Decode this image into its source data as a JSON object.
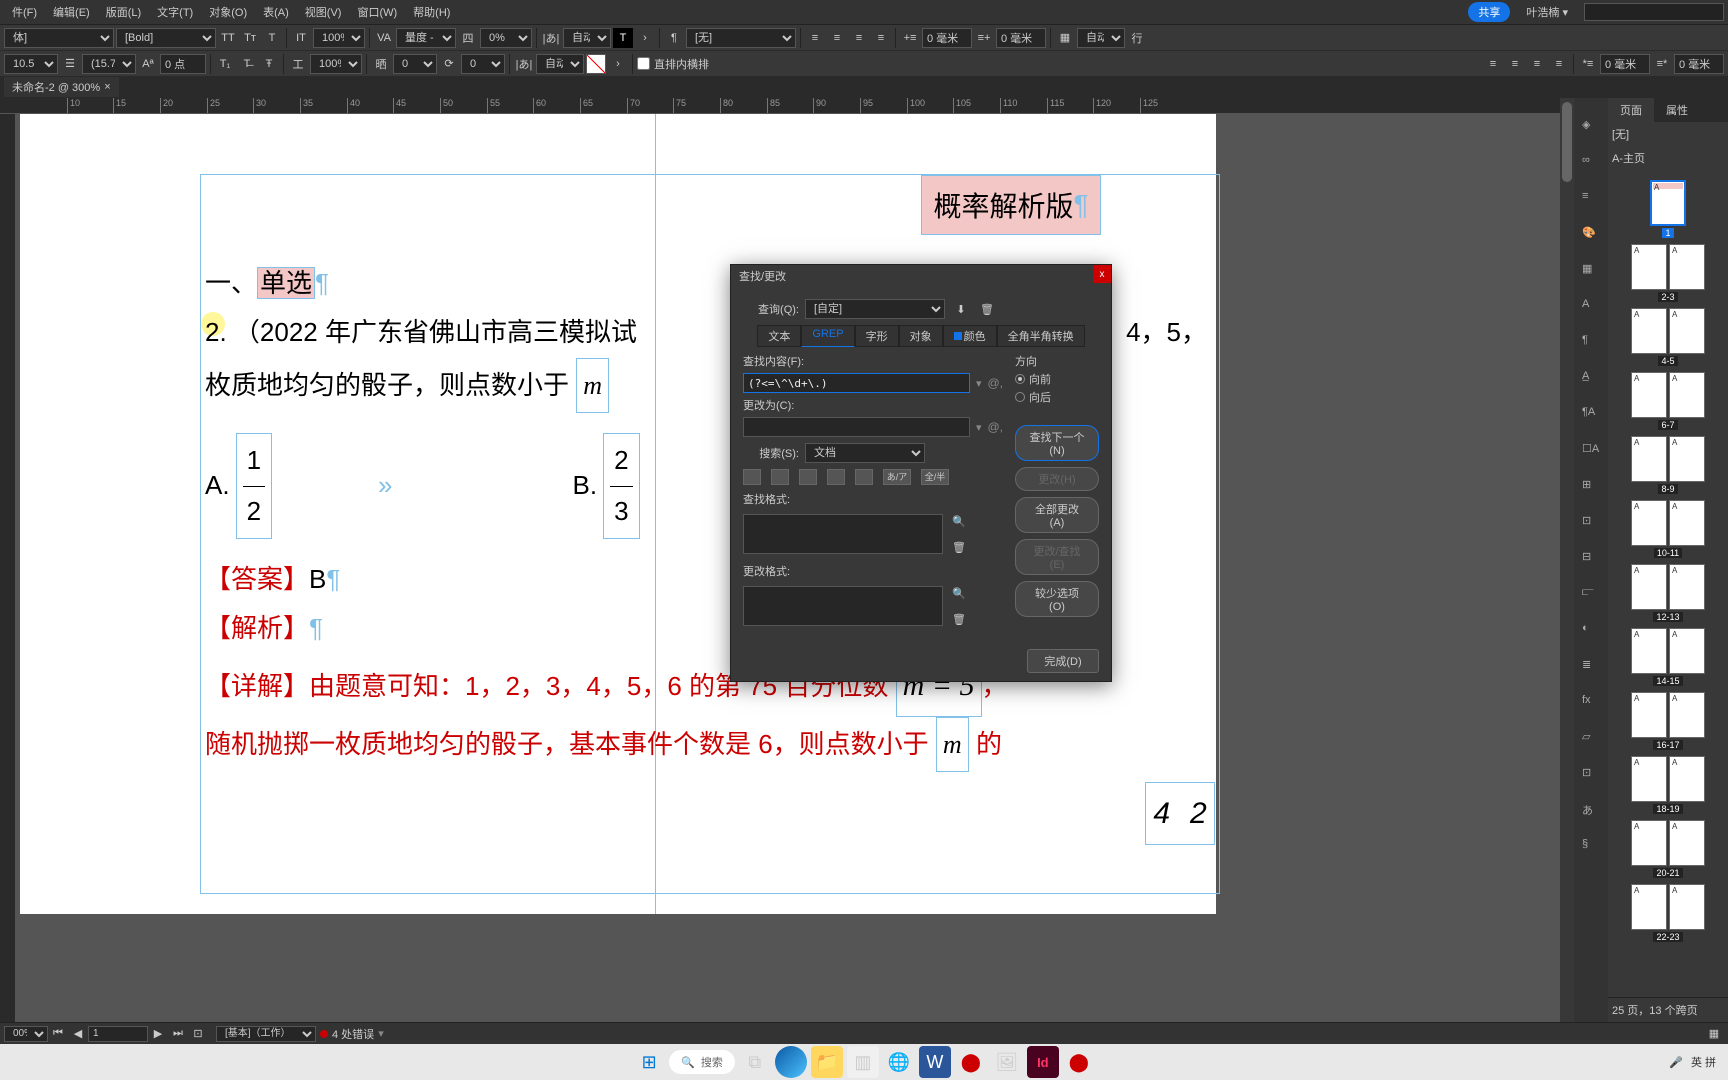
{
  "menubar": {
    "items": [
      "件(F)",
      "编辑(E)",
      "版面(L)",
      "文字(T)",
      "对象(O)",
      "表(A)",
      "视图(V)",
      "窗口(W)",
      "帮助(H)"
    ],
    "share": "共享",
    "user": "叶浩楠"
  },
  "toolbar1": {
    "font_family": "体]",
    "font_style": "[Bold]",
    "scale_pct": "100%",
    "measure_label": "量度 - 优",
    "pct2": "0%",
    "auto1": "自动",
    "style_none": "[无]",
    "left_indent": "0 毫米",
    "right_indent": "0 毫米",
    "columns": "自动",
    "col_icon": "行"
  },
  "toolbar2": {
    "size": "10.5 点",
    "leading": "(15.75 ",
    "baseline": "0 点",
    "scale_pct": "100%",
    "val1": "0",
    "val2": "0",
    "auto2": "自动",
    "checkbox_label": "直排内横排",
    "indent1": "0 毫米",
    "indent2": "0 毫米"
  },
  "doc_tab": "未命名-2 @ 300%",
  "ruler_ticks": [
    "10",
    "15",
    "20",
    "25",
    "30",
    "35",
    "40",
    "45",
    "50",
    "55",
    "60",
    "65",
    "70",
    "75",
    "80",
    "85",
    "90",
    "95",
    "100",
    "105",
    "110",
    "115",
    "120",
    "125"
  ],
  "page": {
    "title_box": "概率解析版",
    "heading_prefix": "一、",
    "heading_text": "单选",
    "q_num": "2.",
    "q_line1": "（2022 年广东省佛山市高三模拟试",
    "q_numbers_right": "4，5，",
    "q_line2": "枚质地均匀的骰子，则点数小于",
    "math_m": "m",
    "opt_a": "A.",
    "opt_a_frac_num": "1",
    "opt_a_frac_den": "2",
    "opt_b": "B.",
    "opt_b_frac_num": "2",
    "opt_b_frac_den": "3",
    "answer_label": "【答案】",
    "answer_val": "B",
    "analysis_label": "【解析】",
    "detail_label": "【详解】",
    "detail_text1": "由题意可知：1，2，3，4，5，6 的第 75 百分位数",
    "math_eq": "m = 5",
    "detail_comma": "，",
    "detail_text2": "随机抛掷一枚质地均匀的骰子，基本事件个数是 6，则点数小于",
    "math_m2": "m",
    "detail_text2_end": "的",
    "frac_bottom_num": "4",
    "frac_bottom_den": "2",
    "arrows": "»"
  },
  "dialog": {
    "title": "查找/更改",
    "query_label": "查询(Q):",
    "query_val": "[自定]",
    "tabs": [
      "文本",
      "GREP",
      "字形",
      "对象",
      "颜色",
      "全角半角转换"
    ],
    "find_label": "查找内容(F):",
    "find_val": "(?<=\\^\\d+\\.)",
    "change_label": "更改为(C):",
    "change_val": "",
    "search_label": "搜索(S):",
    "search_val": "文档",
    "find_format_label": "查找格式:",
    "change_format_label": "更改格式:",
    "direction_label": "方向",
    "dir_fwd": "向前",
    "dir_back": "向后",
    "btn_find_next": "查找下一个(N)",
    "btn_change": "更改(H)",
    "btn_change_all": "全部更改(A)",
    "btn_change_find": "更改/查找(E)",
    "btn_fewer": "较少选项(O)",
    "btn_done": "完成(D)",
    "icon_labels": [
      "あ/ア",
      "全/半"
    ]
  },
  "right_panel": {
    "tab1": "页面",
    "tab2": "属性",
    "master_none": "[无]",
    "master_a": "A-主页",
    "page_ranges": [
      "1",
      "2-3",
      "4-5",
      "6-7",
      "8-9",
      "10-11",
      "12-13",
      "14-15",
      "16-17",
      "18-19",
      "20-21",
      "22-23"
    ],
    "footer": "25 页，13 个跨页"
  },
  "statusbar": {
    "zoom": "00%",
    "page": "1",
    "style": "[基本]（工作）",
    "errors": "4 处错误"
  },
  "taskbar": {
    "search_placeholder": "搜索",
    "ime": "英  拼"
  }
}
